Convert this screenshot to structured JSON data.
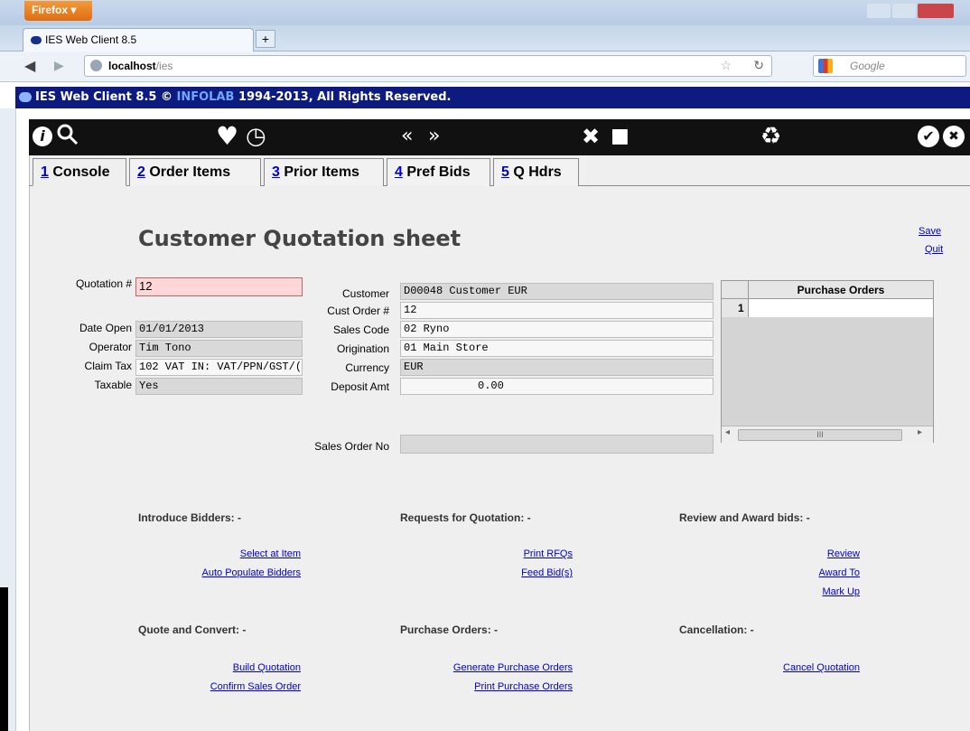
{
  "browser": {
    "menu_button": "Firefox ▾",
    "tab_title": "IES Web Client 8.5",
    "new_tab": "+",
    "url_host": "localhost",
    "url_path": "/ies",
    "search_placeholder": "Google"
  },
  "banner": {
    "title": "IES Web Client 8.5",
    "copyright": "©",
    "brand": "INFOLAB",
    "rights": "1994-2013, All Rights Reserved."
  },
  "toolbar": {
    "info_glyph": "i",
    "search_glyph": "🔍",
    "heart_glyph": "♥",
    "clock_glyph": "◷",
    "back_glyph": "«",
    "fwd_glyph": "»",
    "tools_glyph": "✖",
    "stop_glyph": "■",
    "recycle_glyph": "♻",
    "ok_glyph": "✔",
    "close_glyph": "✖"
  },
  "tabs": [
    {
      "num": "1",
      "label": "Console"
    },
    {
      "num": "2",
      "label": "Order Items"
    },
    {
      "num": "3",
      "label": "Prior Items"
    },
    {
      "num": "4",
      "label": "Pref Bids"
    },
    {
      "num": "5",
      "label": "Q Hdrs"
    }
  ],
  "page": {
    "title": "Customer Quotation sheet",
    "save": "Save",
    "quit": "Quit"
  },
  "fields": {
    "quotation_label": "Quotation #",
    "quotation_value": "12",
    "date_open_label": "Date Open",
    "date_open_value": "01/01/2013",
    "operator_label": "Operator",
    "operator_value": "Tim Tono",
    "claim_tax_label": "Claim Tax",
    "claim_tax_value": "102 VAT IN: VAT/PPN/GST/(",
    "taxable_label": "Taxable",
    "taxable_value": "Yes",
    "customer_label": "Customer",
    "customer_value": "D00048 Customer EUR",
    "cust_order_label": "Cust Order #",
    "cust_order_value": "12",
    "sales_code_label": "Sales Code",
    "sales_code_value": "02 Ryno",
    "origination_label": "Origination",
    "origination_value": "01 Main Store",
    "currency_label": "Currency",
    "currency_value": "EUR",
    "deposit_label": "Deposit Amt",
    "deposit_value": "0.00",
    "sales_order_label": "Sales Order No",
    "sales_order_value": ""
  },
  "purchase_orders": {
    "header": "Purchase Orders",
    "rows": [
      {
        "num": "1",
        "value": ""
      }
    ],
    "scroll_mark": "III"
  },
  "sections": {
    "introduce": {
      "title": "Introduce Bidders: -",
      "links": [
        "Select at Item",
        "Auto Populate Bidders"
      ]
    },
    "rfq": {
      "title": "Requests for Quotation: -",
      "links": [
        "Print RFQs",
        "Feed Bid(s)"
      ]
    },
    "review": {
      "title": "Review and Award bids: -",
      "links": [
        "Review",
        "Award To",
        "Mark Up"
      ]
    },
    "quote": {
      "title": "Quote and Convert: -",
      "links": [
        "Build Quotation",
        "Confirm Sales Order"
      ]
    },
    "po": {
      "title": "Purchase Orders: -",
      "links": [
        "Generate Purchase Orders",
        "Print Purchase Orders"
      ]
    },
    "cancel": {
      "title": "Cancellation: -",
      "links": [
        "Cancel Quotation"
      ]
    }
  }
}
